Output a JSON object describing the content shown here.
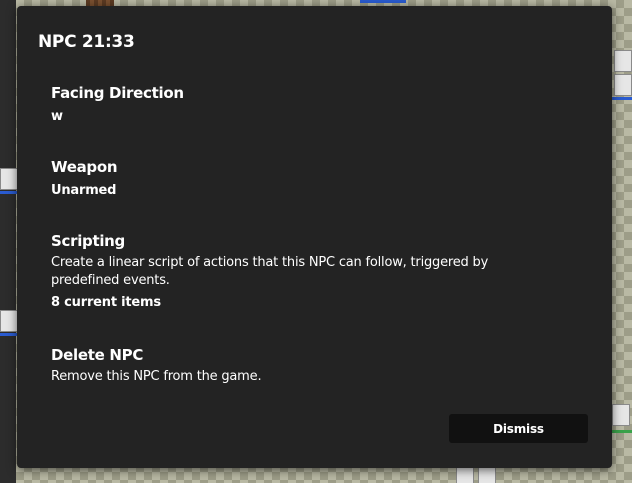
{
  "dialog": {
    "title": "NPC 21:33",
    "sections": [
      {
        "title": "Facing Direction",
        "value": "w"
      },
      {
        "title": "Weapon",
        "value": "Unarmed"
      },
      {
        "title": "Scripting",
        "description": "Create a linear script of actions that this NPC can follow, triggered by predefined events.",
        "count": "8 current items"
      },
      {
        "title": "Delete NPC",
        "description": "Remove this NPC from the game."
      }
    ],
    "dismiss_label": "Dismiss"
  },
  "colors": {
    "dialog_background": "#232323",
    "button_background": "#111111",
    "text": "#ffffff",
    "board_checker_light": "#b9b9a4",
    "board_checker_dark": "#9d9d88",
    "board_blue_line": "#2a5bd0",
    "board_green_line": "#3aa24a"
  }
}
